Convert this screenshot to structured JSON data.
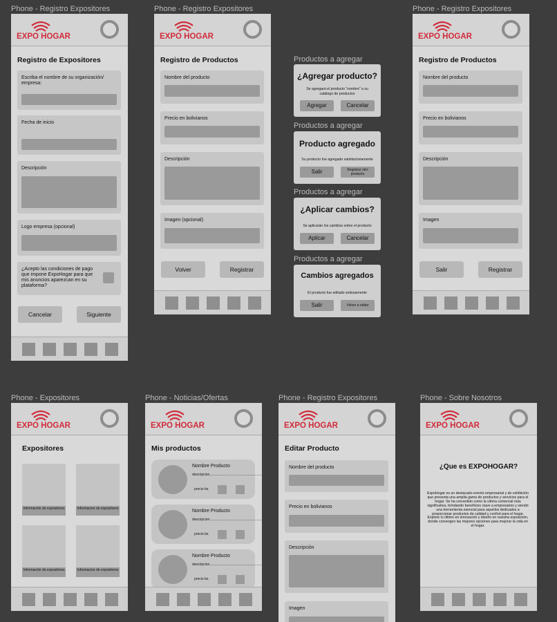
{
  "brand": {
    "logo_text": "EXPO HOGAR",
    "accent_color": "#d22a3a"
  },
  "frames": {
    "f1": "Phone - Registro Expositores",
    "f2": "Phone - Registro Expositores",
    "f3": "Productos a agregar",
    "f3b": "Productos a agregar",
    "f3c": "Productos a agregar",
    "f3d": "Productos a agregar",
    "f4": "Phone - Registro Expositores",
    "f5": "Phone - Expositores",
    "f6": "Phone - Noticias/Ofertas",
    "f7": "Phone - Registro Expositores",
    "f8": "Phone - Sobre Nosotros"
  },
  "registro_expositores": {
    "title": "Registro de Expositores",
    "org_label": "Escriba el nombre de su organización/ empresa:",
    "date_label": "Fecha de inicio",
    "desc_label": "Descripción",
    "logo_label": "Logo empresa (opcional)",
    "terms_label": "¿Acepto las condiciones de pago que impone ExpoHogar para que mis anuncios aparezcan en su plataforma?",
    "cancel": "Cancelar",
    "next": "Siguiente"
  },
  "registro_productos": {
    "title": "Registro de Productos",
    "name_label": "Nombre del producto",
    "price_label": "Precio en bolivianos",
    "desc_label": "Descripción",
    "image_label": "Imagen (opcional)",
    "back": "Volver",
    "register": "Registrar"
  },
  "dialogs": {
    "add": {
      "title": "¿Agregar producto?",
      "message": "Se agregará el producto \"nombre\" a su catálogo de productos",
      "primary": "Agregar",
      "secondary": "Cancelar"
    },
    "added": {
      "title": "Producto agregado",
      "message": "Su producto fue agregado satisfactoriamente",
      "primary": "Salir",
      "secondary": "Registrar otro producto"
    },
    "apply": {
      "title": "¿Aplicar cambios?",
      "message": "Se aplicarán los cambios sobre el producto",
      "primary": "Aplicar",
      "secondary": "Cancelar"
    },
    "applied": {
      "title": "Cambios agregados",
      "message": "El producto fue editado exitosamente",
      "primary": "Salir",
      "secondary": "Volver a editar"
    }
  },
  "registro_productos_2": {
    "title": "Registro de Productos",
    "name_label": "Nombre del producto",
    "price_label": "Precio en bolivianos",
    "desc_label": "Descripción",
    "image_label": "Imagen",
    "exit": "Salir",
    "register": "Registrar"
  },
  "expositores": {
    "title": "Expositores",
    "tile_label": "Información de expositores",
    "tile_label_alt": "Informacion de expositores"
  },
  "mis_productos": {
    "title": "Mis productos",
    "product_name": "Nombre Producto",
    "description": "descripcion..........................................................................",
    "price": "precio bs."
  },
  "editar_producto": {
    "title": "Editar Producto",
    "name_label": "Nombre del producto",
    "price_label": "Precio en bolivianos",
    "desc_label": "Descripción",
    "image_label": "Imagen"
  },
  "sobre_nosotros": {
    "title": "¿Que es EXPOHOGAR?",
    "text": "ExpoHogar es un destacado evento empresarial y de exhibición que presenta una amplia gama de productos y servicios para el hogar. Se ha convertido como la vitrina comercial más significativa, brindando beneficios clave a empresarios y siendo una herramienta esencial para aquellos dedicados a proporcionar productos de calidad y confort para el hogar. Explore lo último en innovación y diseño en nuestra exposición, donde convergen las mejores opciones para mejorar la vida en el hogar."
  }
}
